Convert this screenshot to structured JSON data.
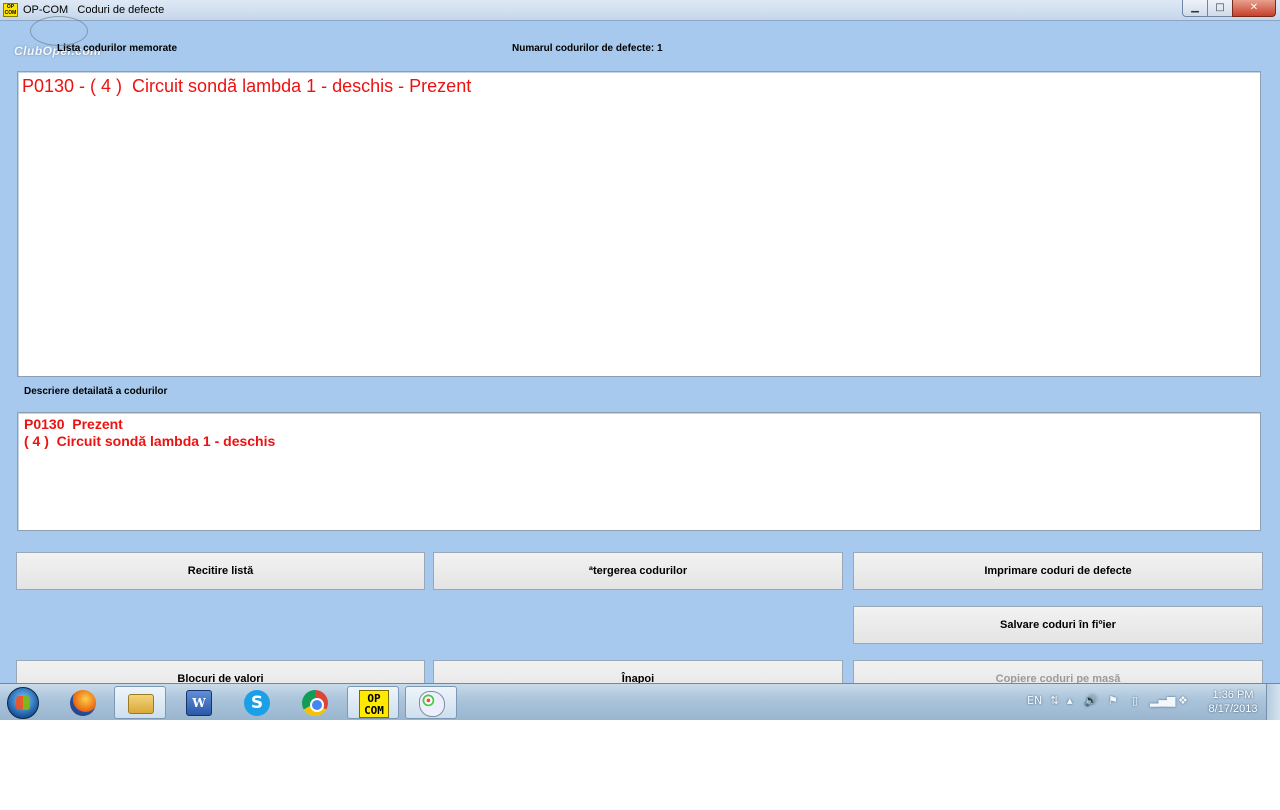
{
  "window": {
    "title": "OP-COM   Coduri de defecte",
    "app_icon_text": "OP\nCOM",
    "minimize_glyph": "▁",
    "maximize_glyph": "□",
    "close_glyph": "✕"
  },
  "watermark": "ClubOpel.com",
  "list": {
    "label": "Lista codurilor memorate",
    "count_label": "Numarul codurilor de defecte: 1",
    "items": [
      "P0130 - ( 4 )  Circuit sondã lambda 1 - deschis - Prezent"
    ]
  },
  "description": {
    "label": "Descriere detailată a codurilor",
    "lines": [
      "P0130  Prezent",
      "( 4 )  Circuit sondă lambda 1 - deschis"
    ]
  },
  "buttons": {
    "reread": "Recitire listă",
    "delete": "ªtergerea codurilor",
    "print": "Imprimare coduri de defecte",
    "save": "Salvare coduri în fiºier",
    "blocks": "Blocuri de valori",
    "back": "Înapoi",
    "copy": "Copiere coduri pe masă"
  },
  "taskbar": {
    "items": [
      {
        "name": "firefox-icon"
      },
      {
        "name": "explorer-icon"
      },
      {
        "name": "word-icon",
        "glyph": "W"
      },
      {
        "name": "skype-icon",
        "glyph": "S"
      },
      {
        "name": "chrome-icon"
      },
      {
        "name": "opcom-icon",
        "glyph": "OP\nCOM"
      },
      {
        "name": "paint-icon"
      }
    ],
    "tray": {
      "language": "EN",
      "time": "1:36 PM",
      "date": "8/17/2013"
    }
  },
  "colors": {
    "background": "#a7c9ee",
    "error_text": "#ee1111"
  }
}
